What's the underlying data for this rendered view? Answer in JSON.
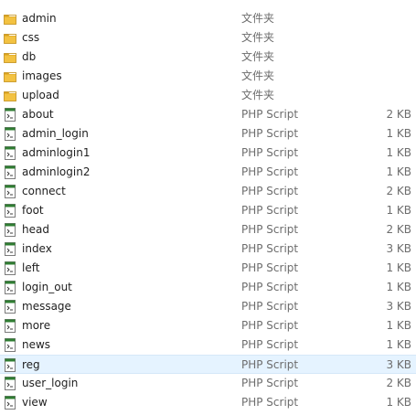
{
  "files": [
    {
      "name": "admin",
      "type": "文件夹",
      "size": "",
      "icon": "folder-icon"
    },
    {
      "name": "css",
      "type": "文件夹",
      "size": "",
      "icon": "folder-icon"
    },
    {
      "name": "db",
      "type": "文件夹",
      "size": "",
      "icon": "folder-icon"
    },
    {
      "name": "images",
      "type": "文件夹",
      "size": "",
      "icon": "folder-icon"
    },
    {
      "name": "upload",
      "type": "文件夹",
      "size": "",
      "icon": "folder-icon"
    },
    {
      "name": "about",
      "type": "PHP Script",
      "size": "2 KB",
      "icon": "php-script-icon"
    },
    {
      "name": "admin_login",
      "type": "PHP Script",
      "size": "1 KB",
      "icon": "php-script-icon"
    },
    {
      "name": "adminlogin1",
      "type": "PHP Script",
      "size": "1 KB",
      "icon": "php-script-icon"
    },
    {
      "name": "adminlogin2",
      "type": "PHP Script",
      "size": "1 KB",
      "icon": "php-script-icon"
    },
    {
      "name": "connect",
      "type": "PHP Script",
      "size": "2 KB",
      "icon": "php-script-icon"
    },
    {
      "name": "foot",
      "type": "PHP Script",
      "size": "1 KB",
      "icon": "php-script-icon"
    },
    {
      "name": "head",
      "type": "PHP Script",
      "size": "2 KB",
      "icon": "php-script-icon"
    },
    {
      "name": "index",
      "type": "PHP Script",
      "size": "3 KB",
      "icon": "php-script-icon"
    },
    {
      "name": "left",
      "type": "PHP Script",
      "size": "1 KB",
      "icon": "php-script-icon"
    },
    {
      "name": "login_out",
      "type": "PHP Script",
      "size": "1 KB",
      "icon": "php-script-icon"
    },
    {
      "name": "message",
      "type": "PHP Script",
      "size": "3 KB",
      "icon": "php-script-icon"
    },
    {
      "name": "more",
      "type": "PHP Script",
      "size": "1 KB",
      "icon": "php-script-icon"
    },
    {
      "name": "news",
      "type": "PHP Script",
      "size": "1 KB",
      "icon": "php-script-icon"
    },
    {
      "name": "reg",
      "type": "PHP Script",
      "size": "3 KB",
      "icon": "php-script-icon",
      "hovered": true
    },
    {
      "name": "user_login",
      "type": "PHP Script",
      "size": "2 KB",
      "icon": "php-script-icon"
    },
    {
      "name": "view",
      "type": "PHP Script",
      "size": "1 KB",
      "icon": "php-script-icon"
    }
  ],
  "colors": {
    "folder": "#f3c241",
    "folder_dark": "#d9a21f",
    "script_accent": "#2f7d32",
    "hover_bg": "#e5f3ff",
    "secondary_text": "#6d6d6d"
  }
}
